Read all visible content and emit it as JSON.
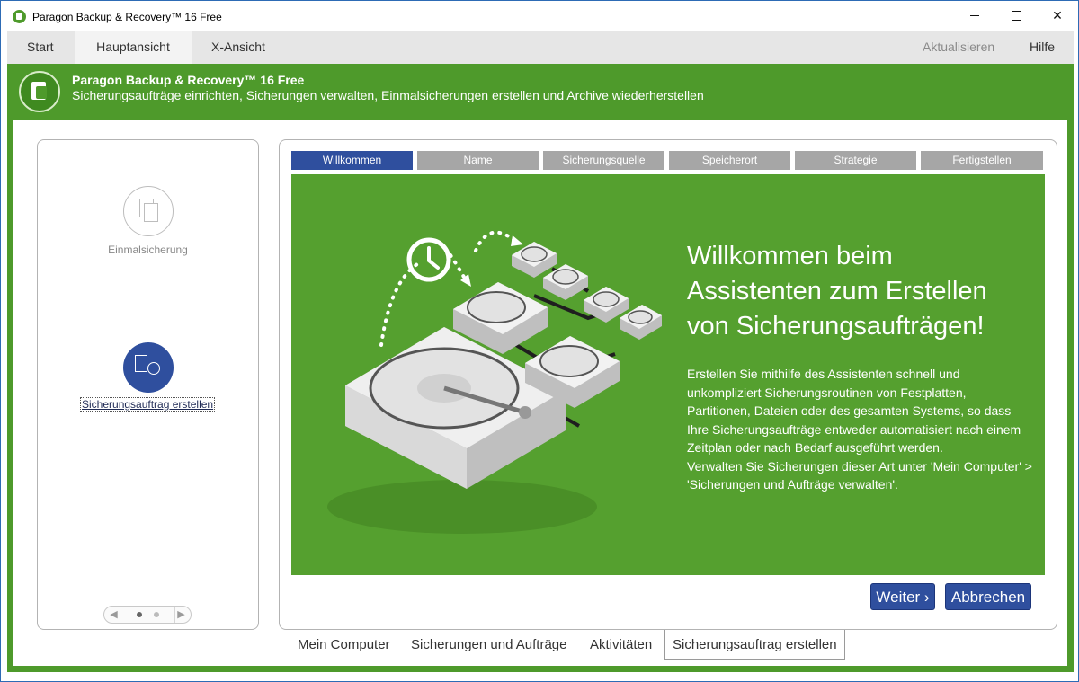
{
  "window": {
    "title": "Paragon Backup & Recovery™ 16 Free"
  },
  "menu": {
    "tabs": [
      "Start",
      "Hauptansicht",
      "X-Ansicht"
    ],
    "active_tab": "Hauptansicht",
    "update": "Aktualisieren",
    "help": "Hilfe"
  },
  "header": {
    "title": "Paragon Backup & Recovery™ 16 Free",
    "subtitle": "Sicherungsaufträge einrichten, Sicherungen verwalten, Einmalsicherungen erstellen und Archive wiederherstellen"
  },
  "left_panel": {
    "items": [
      {
        "label": "Einmalsicherung",
        "icon": "document-copy-icon"
      },
      {
        "label": "Sicherungsauftrag erstellen",
        "icon": "scheduled-backup-icon"
      }
    ]
  },
  "wizard": {
    "steps": [
      "Willkommen",
      "Name",
      "Sicherungsquelle",
      "Speicherort",
      "Strategie",
      "Fertigstellen"
    ],
    "active_step": "Willkommen",
    "title": "Willkommen beim Assistenten zum Erstellen von Sicherungsaufträgen!",
    "body": "Erstellen Sie mithilfe des Assistenten schnell und unkompliziert Sicherungsroutinen von Festplatten, Partitionen, Dateien oder des gesamten Systems, so dass Ihre Sicherungsaufträge entweder automatisiert nach einem Zeitplan oder nach Bedarf ausgeführt werden.",
    "body2": "Verwalten Sie Sicherungen dieser Art unter 'Mein Computer' > 'Sicherungen und Aufträge verwalten'.",
    "next_button": "Weiter ›",
    "cancel_button": "Abbrechen"
  },
  "bottom_tabs": {
    "items": [
      "Mein Computer",
      "Sicherungen und Aufträge",
      "Aktivitäten",
      "Sicherungsauftrag erstellen"
    ],
    "active": "Sicherungsauftrag erstellen"
  },
  "colors": {
    "brand_green": "#4e9a2b",
    "accent_blue": "#2f4f9e",
    "step_gray": "#a6a6a6"
  }
}
